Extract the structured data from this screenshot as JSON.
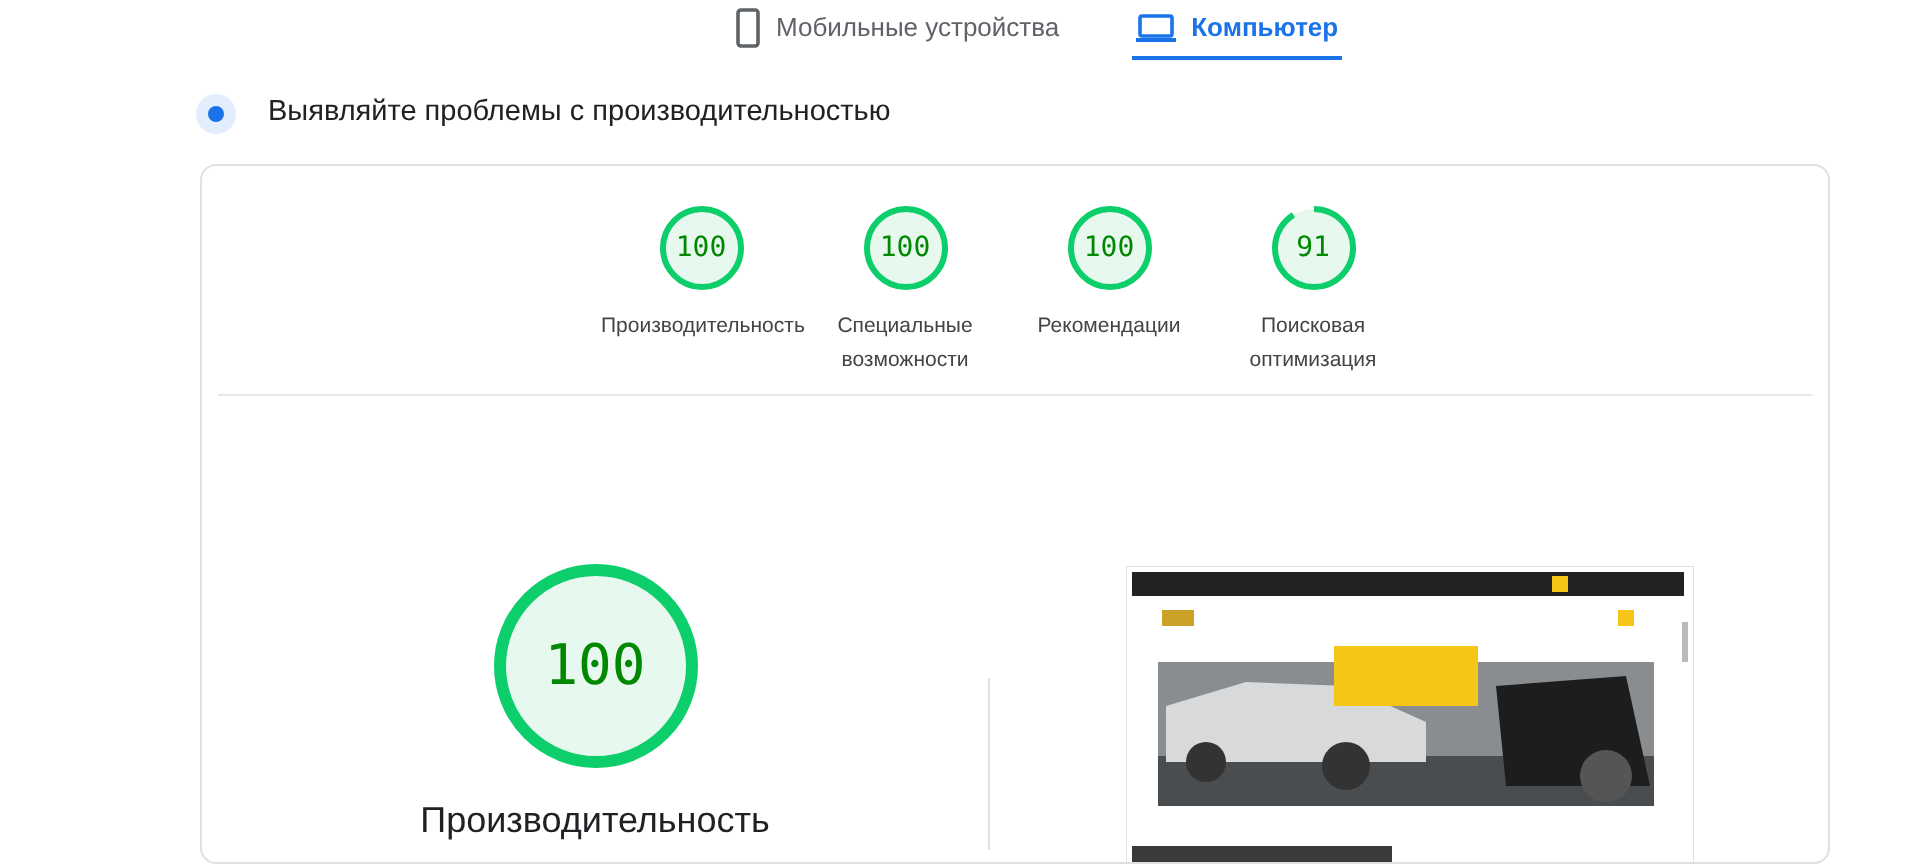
{
  "tabs": [
    {
      "label": "Мобильные устройства",
      "kind": "mobile",
      "selected": false
    },
    {
      "label": "Компьютер",
      "kind": "desktop",
      "selected": true
    }
  ],
  "heading": "Выявляйте проблемы с производительностью",
  "scores": [
    {
      "value": "100",
      "level": 1,
      "label": "Производительность"
    },
    {
      "value": "100",
      "level": 1,
      "label": "Специальные возможности"
    },
    {
      "value": "100",
      "level": 1,
      "label": "Рекомендации"
    },
    {
      "value": "91",
      "level": 0.91,
      "label": "Поисковая оптимизация"
    }
  ],
  "main_score": {
    "value": "100",
    "level": 1,
    "label": "Производительность"
  }
}
